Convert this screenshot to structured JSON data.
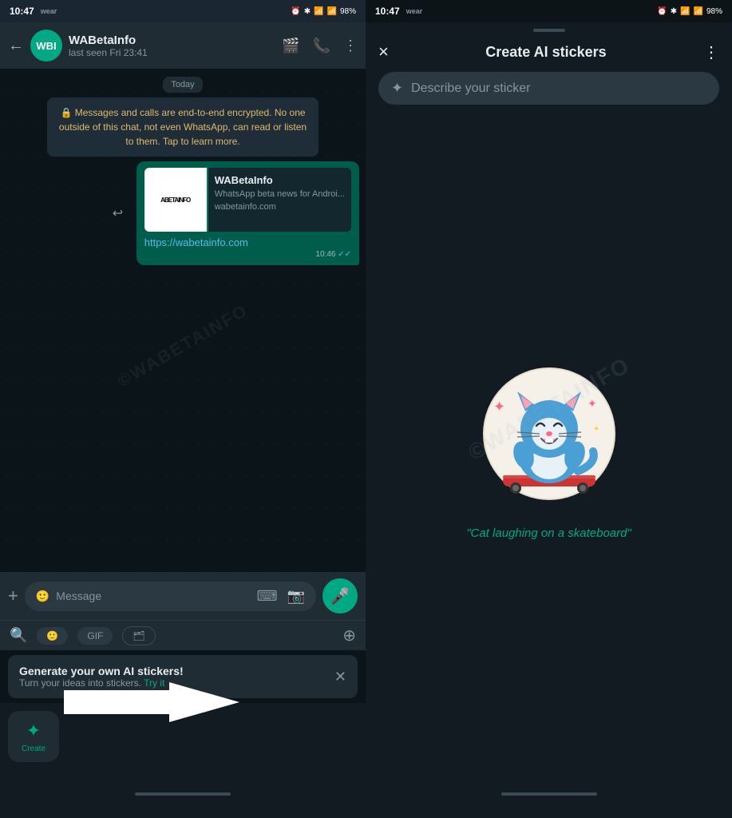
{
  "left": {
    "statusBar": {
      "time": "10:47",
      "wear": "wear",
      "battery": "98%"
    },
    "chatHeader": {
      "avatarText": "WBI",
      "contactName": "WABetaInfo",
      "contactStatus": "last seen Fri 23:41"
    },
    "dateBadge": "Today",
    "encryptionNotice": "🔒 Messages and calls are end-to-end encrypted. No one outside of this chat, not even WhatsApp, can read or listen to them. Tap to learn more.",
    "linkPreview": {
      "imgText": "ABETAINFO",
      "title": "WABetaInfo",
      "desc": "WhatsApp beta news for Androi...",
      "domain": "wabetainfo.com"
    },
    "linkUrl": "https://wabetainfo.com",
    "msgTime": "10:46",
    "inputPlaceholder": "Message",
    "stickerBanner": {
      "title": "Generate your own AI stickers!",
      "subtitle": "Turn your ideas into stickers.",
      "tryIt": "Try it"
    },
    "createBtn": "Create"
  },
  "right": {
    "statusBar": {
      "time": "10:47",
      "wear": "wear",
      "battery": "98%"
    },
    "header": {
      "title": "Create AI stickers",
      "closeLabel": "×",
      "moreLabel": "⋮"
    },
    "searchPlaceholder": "Describe your sticker",
    "stickerCaption": "\"Cat laughing on a skateboard\""
  },
  "icons": {
    "back": "←",
    "videoCall": "📹",
    "phoneCall": "📞",
    "more": "⋮",
    "plus": "+",
    "emoji": "🙂",
    "gif": "GIF",
    "camera": "📷",
    "mic": "🎤",
    "search": "🔍",
    "forward": "↩",
    "close": "✕",
    "sparkle": "✦",
    "sticker": "🗂"
  }
}
